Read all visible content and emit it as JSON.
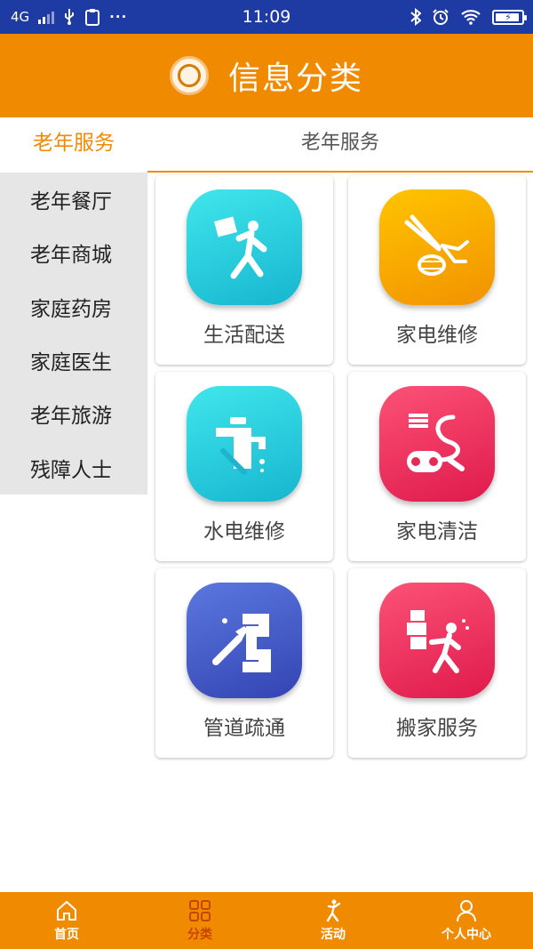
{
  "status_bar": {
    "network": "4G",
    "time": "11:09",
    "more": "···"
  },
  "header": {
    "title": "信息分类",
    "logo_icon": "logo-emblem-icon"
  },
  "tabs": {
    "left_label": "老年服务",
    "right_label": "老年服务"
  },
  "sidebar": {
    "items": [
      {
        "label": "老年餐厅"
      },
      {
        "label": "老年商城"
      },
      {
        "label": "家庭药房"
      },
      {
        "label": "家庭医生"
      },
      {
        "label": "老年旅游"
      },
      {
        "label": "残障人士"
      }
    ]
  },
  "grid": {
    "items": [
      {
        "label": "生活配送",
        "icon": "delivery-person-icon",
        "color": "#1fc3d8"
      },
      {
        "label": "家电维修",
        "icon": "pliers-wire-icon",
        "color": "#f7a400"
      },
      {
        "label": "水电维修",
        "icon": "faucet-wrench-icon",
        "color": "#1fc3d8"
      },
      {
        "label": "家电清洁",
        "icon": "vacuum-cleaner-icon",
        "color": "#ee2d5b"
      },
      {
        "label": "管道疏通",
        "icon": "pipe-wrench-icon",
        "color": "#4356c6"
      },
      {
        "label": "搬家服务",
        "icon": "mover-boxes-icon",
        "color": "#ee2d5b"
      }
    ]
  },
  "bottom_nav": {
    "items": [
      {
        "label": "首页",
        "icon": "home-icon"
      },
      {
        "label": "分类",
        "icon": "grid-icon",
        "active": true
      },
      {
        "label": "活动",
        "icon": "dancer-icon"
      },
      {
        "label": "个人中心",
        "icon": "person-icon"
      }
    ]
  },
  "colors": {
    "accent": "#f08a00",
    "status_bar": "#1e3aa3",
    "sidebar_bg": "#e6e6e6"
  }
}
